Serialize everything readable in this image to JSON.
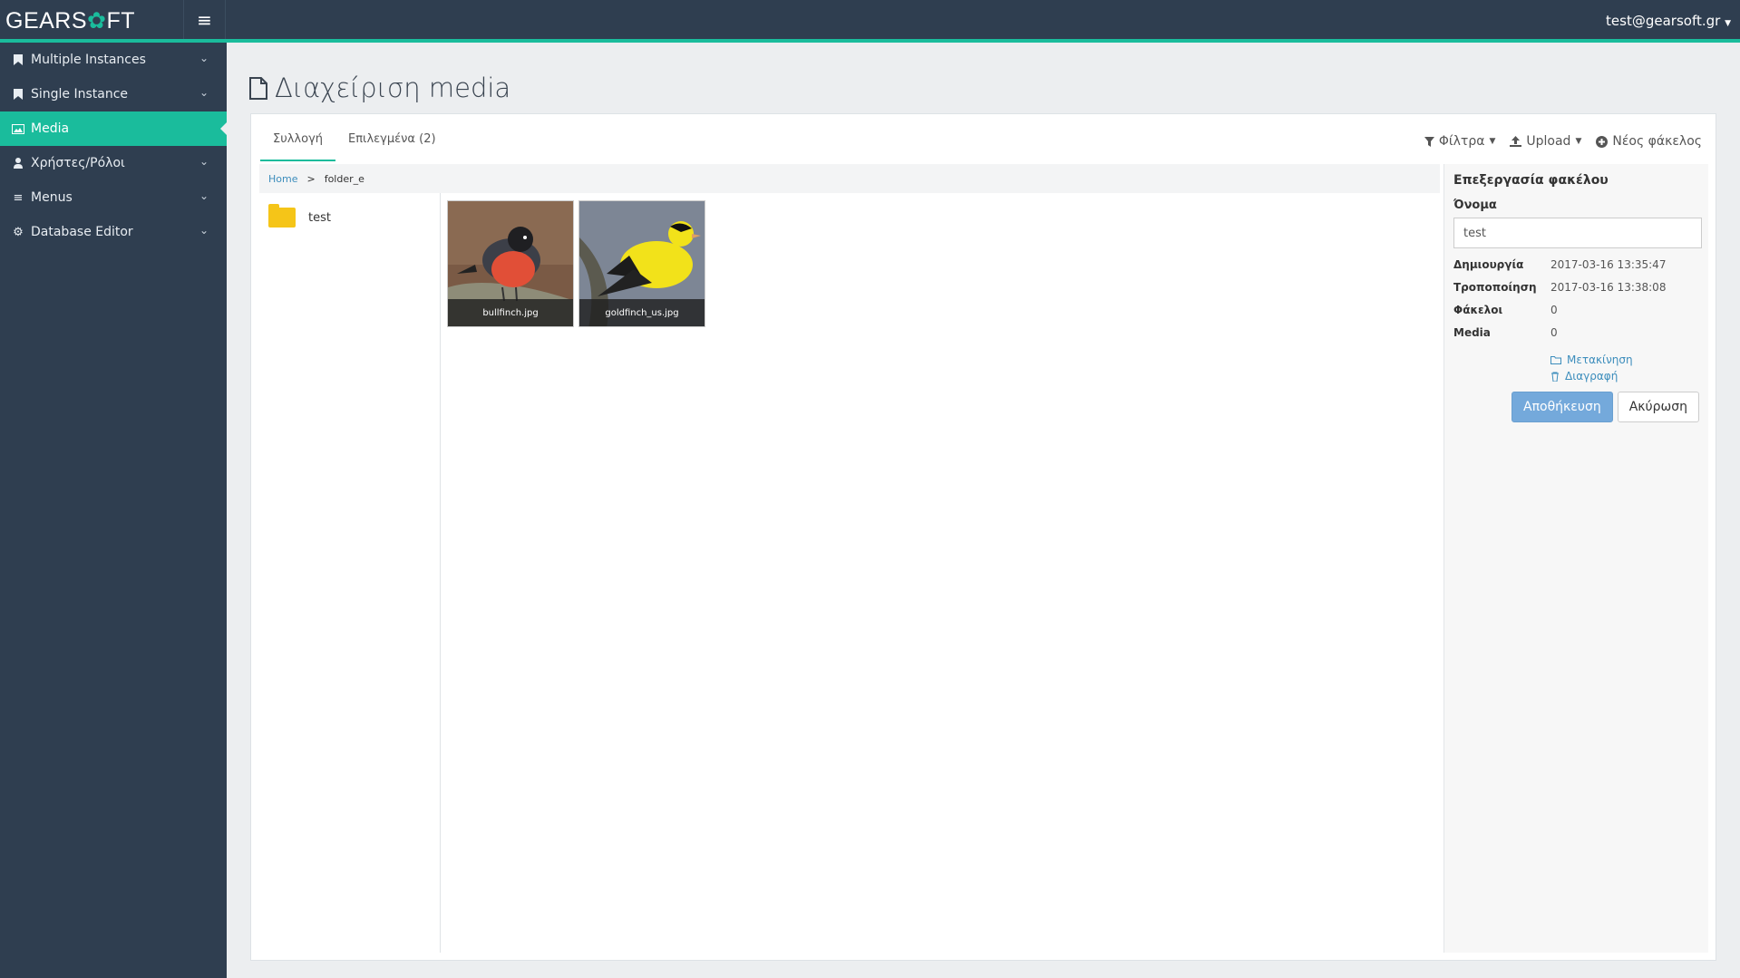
{
  "header": {
    "brand_prefix": "GEARS",
    "brand_suffix": "FT",
    "user": "test@gearsoft.gr",
    "accent_color": "#1abc9c"
  },
  "sidebar": {
    "items": [
      {
        "label": "Multiple Instances",
        "icon": "bookmark-icon"
      },
      {
        "label": "Single Instance",
        "icon": "bookmark-icon"
      },
      {
        "label": "Media",
        "icon": "image-icon"
      },
      {
        "label": "Χρήστες/Ρόλοι",
        "icon": "user-icon"
      },
      {
        "label": "Menus",
        "icon": "list-icon"
      },
      {
        "label": "Database Editor",
        "icon": "gear-icon"
      }
    ]
  },
  "page": {
    "title": "Διαχείριση media"
  },
  "tabs": [
    {
      "label": "Συλλογή"
    },
    {
      "label": "Επιλεγμένα (2)"
    }
  ],
  "toolbar": {
    "filters": "Φίλτρα",
    "upload": "Upload",
    "new_folder": "Νέος φάκελος"
  },
  "breadcrumb": {
    "home": "Home",
    "separator": ">",
    "current": "folder_e"
  },
  "folders": [
    {
      "name": "test"
    }
  ],
  "media": [
    {
      "filename": "bullfinch.jpg"
    },
    {
      "filename": "goldfinch_us.jpg"
    }
  ],
  "edit_panel": {
    "title": "Επεξεργασία φακέλου",
    "name_label": "Όνομα",
    "name_value": "test",
    "rows": [
      {
        "key": "Δημιουργία",
        "value": "2017-03-16 13:35:47"
      },
      {
        "key": "Τροποποίηση",
        "value": "2017-03-16 13:38:08"
      },
      {
        "key": "Φάκελοι",
        "value": "0"
      },
      {
        "key": "Media",
        "value": "0"
      }
    ],
    "move_label": "Μετακίνηση",
    "delete_label": "Διαγραφή",
    "save_label": "Αποθήκευση",
    "cancel_label": "Ακύρωση"
  }
}
